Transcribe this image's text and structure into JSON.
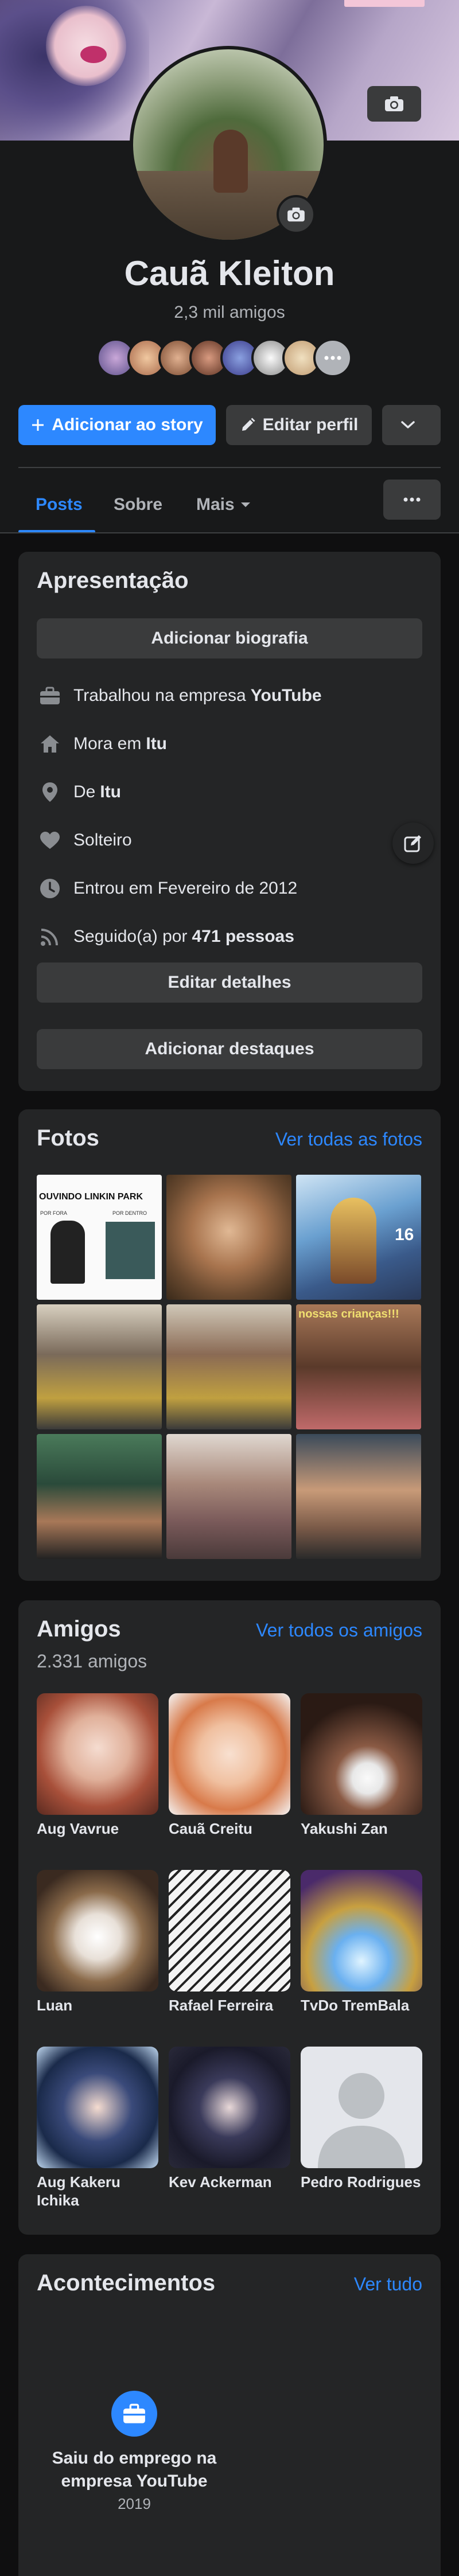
{
  "profile": {
    "name": "Cauã Kleiton",
    "friend_count": "2,3 mil amigos"
  },
  "actions": {
    "add_story": "Adicionar ao story",
    "edit_profile": "Editar perfil"
  },
  "tabs": [
    {
      "label": "Posts",
      "active": true
    },
    {
      "label": "Sobre"
    },
    {
      "label": "Mais"
    }
  ],
  "intro": {
    "title": "Apresentação",
    "add_bio": "Adicionar biografia",
    "work": {
      "prefix": "Trabalhou na empresa",
      "value": "YouTube"
    },
    "lives": {
      "prefix": "Mora em",
      "value": "Itu"
    },
    "from": {
      "prefix": "De",
      "value": "Itu"
    },
    "relationship": "Solteiro",
    "joined": "Entrou em Fevereiro de 2012",
    "followers": {
      "prefix": "Seguido(a) por",
      "value": "471 pessoas"
    },
    "edit_details": "Editar detalhes",
    "add_highlights": "Adicionar destaques"
  },
  "photos": {
    "title": "Fotos",
    "see_all": "Ver todas as fotos",
    "overlay_texts": {
      "p1_top": "OUVINDO LINKIN PARK",
      "p1_left": "POR FORA",
      "p1_right": "POR DENTRO",
      "p3_num": "16",
      "p6": "nossas crianças!!!"
    }
  },
  "friends": {
    "title": "Amigos",
    "see_all": "Ver todos os amigos",
    "count": "2.331 amigos",
    "list": [
      {
        "name": "Aug Vavrue"
      },
      {
        "name": "Cauã Creitu"
      },
      {
        "name": "Yakushi Zan"
      },
      {
        "name": "Luan"
      },
      {
        "name": "Rafael Ferreira"
      },
      {
        "name": "TvDo TremBala"
      },
      {
        "name": "Aug Kakeru Ichika"
      },
      {
        "name": "Kev Ackerman"
      },
      {
        "name": "Pedro Rodrigues"
      }
    ]
  },
  "events": {
    "title": "Acontecimentos",
    "see_all": "Ver tudo",
    "item": {
      "title": "Saiu do emprego na empresa YouTube",
      "year": "2019"
    }
  },
  "colors": {
    "accent": "#2d88ff",
    "background": "#18191a",
    "card": "#242526",
    "button": "#3a3b3c"
  }
}
